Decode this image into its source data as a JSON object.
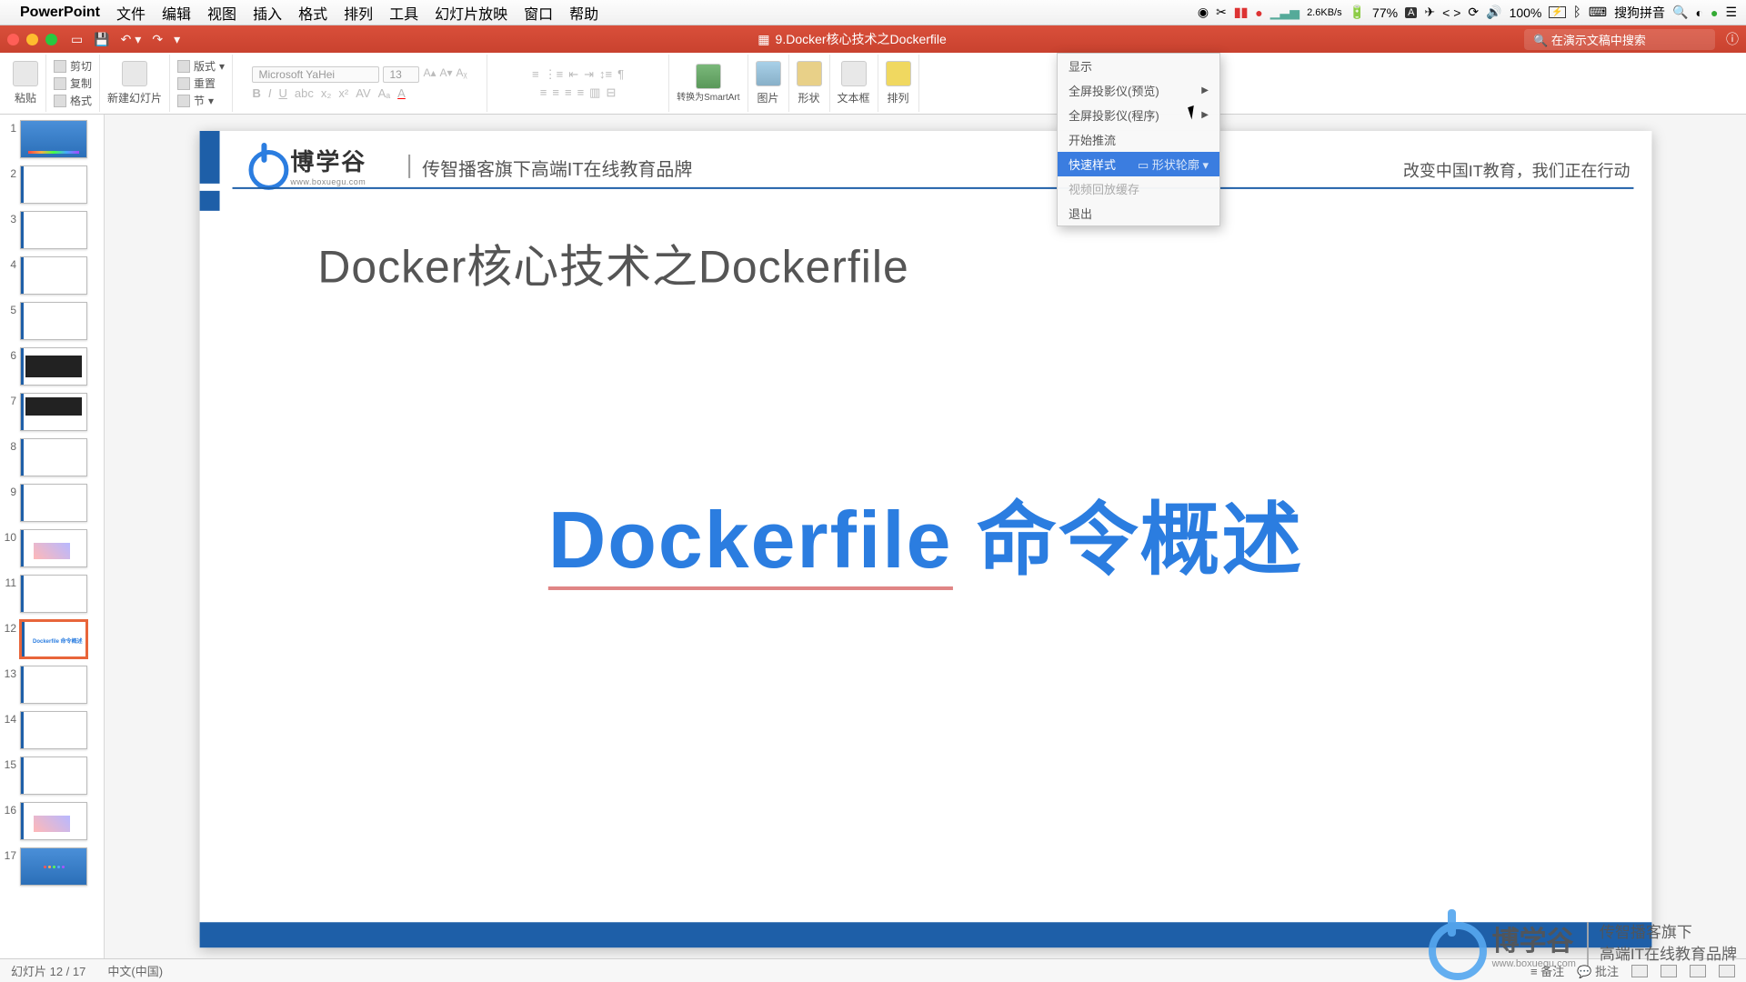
{
  "menubar": {
    "app": "PowerPoint",
    "items": [
      "文件",
      "编辑",
      "视图",
      "插入",
      "格式",
      "排列",
      "工具",
      "幻灯片放映",
      "窗口",
      "帮助"
    ],
    "right": {
      "net": "2.6KB/s",
      "battery": "77%",
      "vol": "100%",
      "ime": "搜狗拼音"
    }
  },
  "titlebar": {
    "doc": "9.Docker核心技术之Dockerfile",
    "search_placeholder": "在演示文稿中搜索"
  },
  "ribbon": {
    "paste": "粘贴",
    "cut": "剪切",
    "copy": "复制",
    "format": "格式",
    "new_slide": "新建幻灯片",
    "layout": "版式",
    "reset": "重置",
    "section": "节",
    "font": "Microsoft YaHei",
    "size": "13",
    "smartart": "转换为SmartArt",
    "picture": "图片",
    "shapes": "形状",
    "textbox": "文本框",
    "arrange": "排列"
  },
  "dropdown": {
    "i1": "显示",
    "i2": "全屏投影仪(预览)",
    "i3": "全屏投影仪(程序)",
    "i4": "开始推流",
    "i5": "快速样式",
    "i5b": "形状轮廓",
    "i6": "视频回放缓存",
    "i7": "退出"
  },
  "slides": {
    "count": 17,
    "selected": 12
  },
  "slide": {
    "logo_cn": "博学谷",
    "logo_en": "www.boxuegu.com",
    "header_sub": "传智播客旗下高端IT在线教育品牌",
    "header_right": "改变中国IT教育，我们正在行动",
    "subtitle": "Docker核心技术之Dockerfile",
    "main": "Dockerfile 命令概述"
  },
  "watermark": {
    "cn": "博学谷",
    "en": "www.boxuegu.com",
    "r1": "传智播客旗下",
    "r2": "高端IT在线教育品牌"
  },
  "status": {
    "slide": "幻灯片 12 / 17",
    "lang": "中文(中国)",
    "notes": "备注",
    "comments": "批注"
  }
}
